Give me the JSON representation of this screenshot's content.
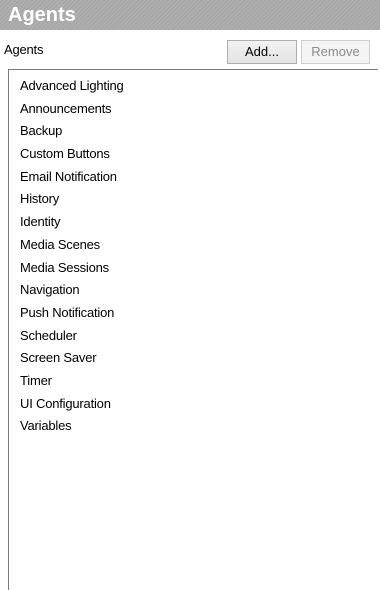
{
  "panel": {
    "title": "Agents",
    "section_label": "Agents"
  },
  "toolbar": {
    "add_label": "Add...",
    "remove_label": "Remove",
    "remove_enabled": false
  },
  "agents": {
    "items": [
      {
        "label": "Advanced Lighting"
      },
      {
        "label": "Announcements"
      },
      {
        "label": "Backup"
      },
      {
        "label": "Custom Buttons"
      },
      {
        "label": "Email Notification"
      },
      {
        "label": "History"
      },
      {
        "label": "Identity"
      },
      {
        "label": "Media Scenes"
      },
      {
        "label": "Media Sessions"
      },
      {
        "label": "Navigation"
      },
      {
        "label": "Push Notification"
      },
      {
        "label": "Scheduler"
      },
      {
        "label": "Screen Saver"
      },
      {
        "label": "Timer"
      },
      {
        "label": "UI Configuration"
      },
      {
        "label": "Variables"
      }
    ]
  },
  "colors": {
    "title_bar": "#a8a8a8",
    "title_text": "#ffffff",
    "disabled_text": "#8c8c8c"
  }
}
